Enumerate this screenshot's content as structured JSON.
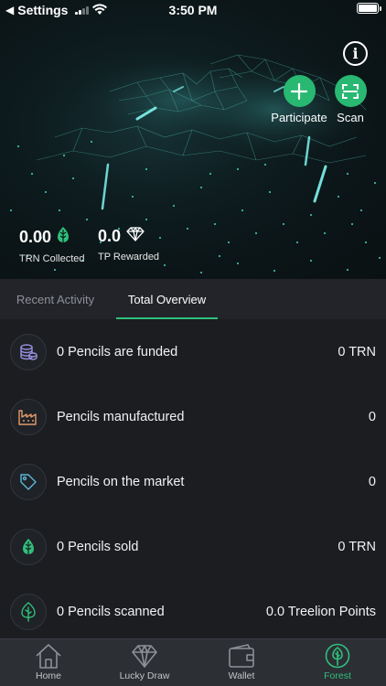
{
  "status_bar": {
    "back_app": "Settings",
    "time": "3:50 PM"
  },
  "hero": {
    "info_icon": "info-icon",
    "actions": [
      {
        "label": "Participate",
        "icon": "plus-icon"
      },
      {
        "label": "Scan",
        "icon": "scan-icon"
      }
    ],
    "stats": {
      "trn": {
        "value": "0.00",
        "label": "TRN Collected",
        "icon": "leaf-icon"
      },
      "tp": {
        "value": "0.0",
        "label": "TP Rewarded",
        "icon": "diamond-icon"
      }
    }
  },
  "tabs": {
    "recent": "Recent Activity",
    "overview": "Total Overview",
    "active": "overview"
  },
  "rows": [
    {
      "label": "0 Pencils are funded",
      "value": "0 TRN",
      "icon": "coins-icon"
    },
    {
      "label": "Pencils manufactured",
      "value": "0",
      "icon": "factory-icon"
    },
    {
      "label": "Pencils on the market",
      "value": "0",
      "icon": "tag-icon"
    },
    {
      "label": "0 Pencils sold",
      "value": "0 TRN",
      "icon": "leaf-icon"
    },
    {
      "label": "0 Pencils scanned",
      "value": "0.0 Treelion Points",
      "icon": "tree-icon"
    }
  ],
  "tabbar": {
    "items": [
      {
        "label": "Home",
        "icon": "home-icon"
      },
      {
        "label": "Lucky Draw",
        "icon": "diamond-icon"
      },
      {
        "label": "Wallet",
        "icon": "wallet-icon"
      },
      {
        "label": "Forest",
        "icon": "tree-icon"
      }
    ],
    "active": "Forest"
  },
  "colors": {
    "accent": "#2fc07c",
    "background": "#1b1d21",
    "coins_icon": "#9b8fe0",
    "factory_icon": "#e49a6b",
    "tag_icon": "#5bb8d9"
  }
}
